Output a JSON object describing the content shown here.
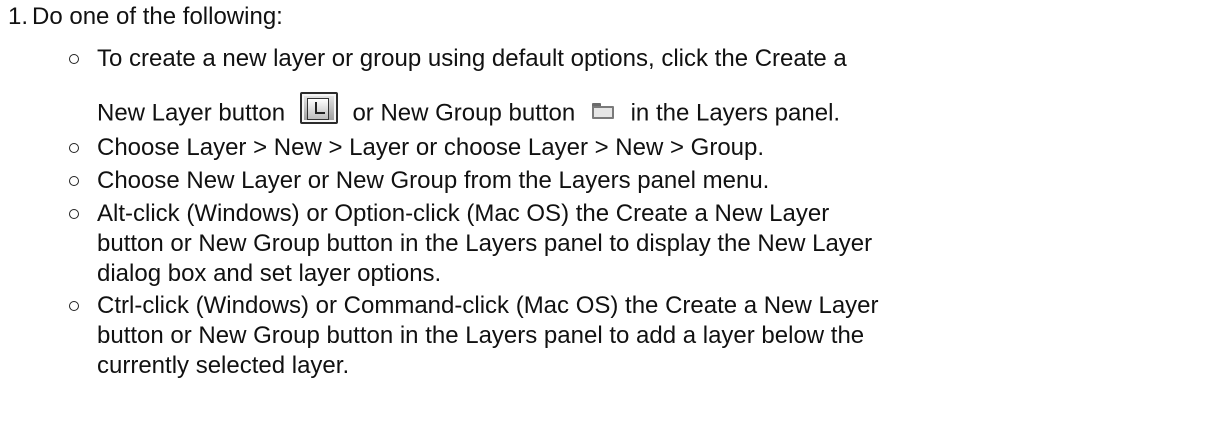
{
  "step": {
    "number": "1.",
    "text": "Do one of the following:"
  },
  "options": [
    {
      "lines": [
        "To create a new layer or group using default options, click the Create a"
      ],
      "continuation": {
        "before_icon1": "New Layer button",
        "between_icons": "or New Group button",
        "after_icon2": "in the Layers panel."
      }
    },
    {
      "lines": [
        "Choose Layer > New > Layer or choose Layer > New > Group."
      ]
    },
    {
      "lines": [
        "Choose New Layer or New Group from the Layers panel menu."
      ]
    },
    {
      "lines": [
        "Alt-click (Windows) or Option-click (Mac OS) the Create a New Layer",
        "button or New Group button in the Layers panel to display the New Layer",
        "dialog box and set layer options."
      ]
    },
    {
      "lines": [
        "Ctrl-click (Windows) or Command-click (Mac OS) the Create a New Layer",
        "button or New Group button in the Layers panel to add a layer below the",
        "currently selected layer."
      ]
    }
  ],
  "icons": {
    "new_layer": "new-layer-icon",
    "new_group": "folder-icon"
  },
  "colors": {
    "text": "#111111",
    "heading": "#4a90c8"
  }
}
